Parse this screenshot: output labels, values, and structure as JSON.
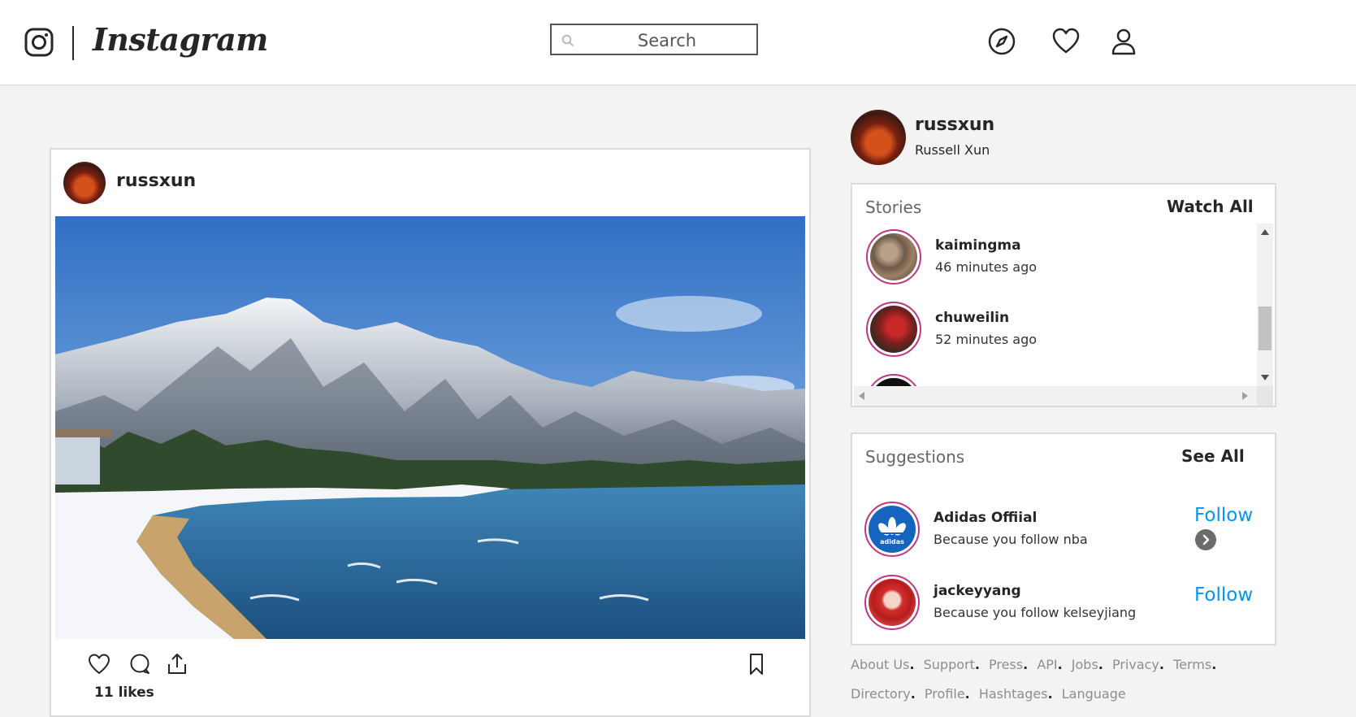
{
  "header": {
    "brand": "Instagram",
    "search": {
      "placeholder": "Search",
      "value": ""
    },
    "icons": [
      "compass-icon",
      "heart-icon",
      "profile-icon"
    ]
  },
  "post": {
    "username": "russxun",
    "likes": "11 likes",
    "image_alt": "snowy mountain lake landscape"
  },
  "profile": {
    "username": "russxun",
    "full_name": "Russell Xun"
  },
  "stories": {
    "title": "Stories",
    "watch_all": "Watch All",
    "items": [
      {
        "username": "kaimingma",
        "time": "46 minutes ago"
      },
      {
        "username": "chuweilin",
        "time": "52 minutes ago"
      },
      {
        "username": "",
        "time": ""
      }
    ]
  },
  "suggestions": {
    "title": "Suggestions",
    "see_all": "See All",
    "items": [
      {
        "name": "Adidas Offiial",
        "reason": "Because you follow nba",
        "action": "Follow",
        "logo_text": "adidas"
      },
      {
        "name": "jackeyyang",
        "reason": "Because you follow kelseyjiang",
        "action": "Follow"
      }
    ]
  },
  "footer": {
    "links": [
      "About Us",
      "Support",
      "Press",
      "API",
      "Jobs",
      "Privacy",
      "Terms",
      "Directory",
      "Profile",
      "Hashtages",
      "Language"
    ]
  },
  "colors": {
    "accent": "#0095f6",
    "story_ring": "#c13584",
    "background": "#f3f3f3"
  }
}
